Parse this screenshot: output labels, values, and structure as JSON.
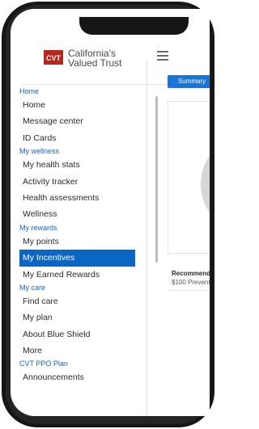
{
  "brand": {
    "line1": "California's",
    "line2": "Valued Trust",
    "logo_text": "CVT",
    "color": "#b5261e"
  },
  "nav": {
    "home_section": "Home",
    "home_items": [
      "Home",
      "Message center",
      "ID Cards"
    ],
    "wellness_section": "My wellness",
    "wellness_items": [
      "My health stats",
      "Activity tracker",
      "Health assessments",
      "Wellness"
    ],
    "rewards_section": "My rewards",
    "rewards_items": [
      "My points",
      "My Incentives",
      "My Earned Rewards"
    ],
    "care_section": "My care",
    "care_items": [
      "Find care",
      "My plan",
      "About Blue Shield",
      "More"
    ],
    "plan_section": "CVT PPO Plan",
    "plan_items": [
      "Announcements"
    ],
    "active_item": "My Incentives"
  },
  "main": {
    "tab_label": "Summary",
    "reco_title": "Recommende",
    "reco_sub": "$100 Prevent"
  },
  "icons": {
    "menu": "hamburger-menu-icon",
    "logo": "cvt-logo-icon"
  },
  "colors": {
    "accent": "#0a66c2",
    "section": "#1565c0"
  }
}
